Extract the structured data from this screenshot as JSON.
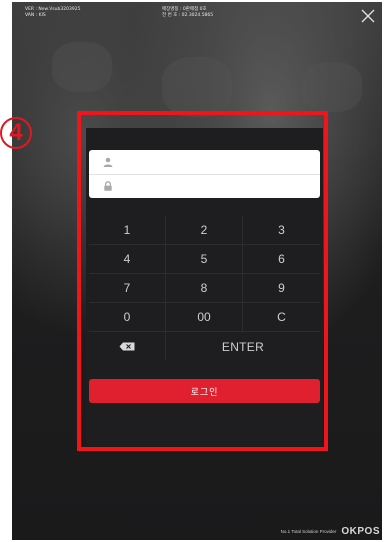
{
  "header": {
    "left_line1": "VER : New.Vsub3203925",
    "left_line2": "VAN : KIS",
    "mid_line1": "매장명칭 : 0판매점 0호",
    "mid_line2": "전 번 호 : 02.3024.5865"
  },
  "annotation": {
    "number": "4"
  },
  "login": {
    "username_placeholder": "",
    "password_placeholder": "",
    "keypad": [
      "1",
      "2",
      "3",
      "4",
      "5",
      "6",
      "7",
      "8",
      "9",
      "0",
      "00",
      "C"
    ],
    "enter_label": "ENTER",
    "submit_label": "로그인"
  },
  "footer": {
    "tagline": "No.1 Total Solution Provider",
    "brand": "OKPOS"
  },
  "colors": {
    "accent": "#e0202f",
    "annotation": "#f0141c",
    "panel": "#1e1e20"
  },
  "icons": {
    "close": "close-icon",
    "user": "user-icon",
    "lock": "lock-icon",
    "backspace": "backspace-icon"
  }
}
